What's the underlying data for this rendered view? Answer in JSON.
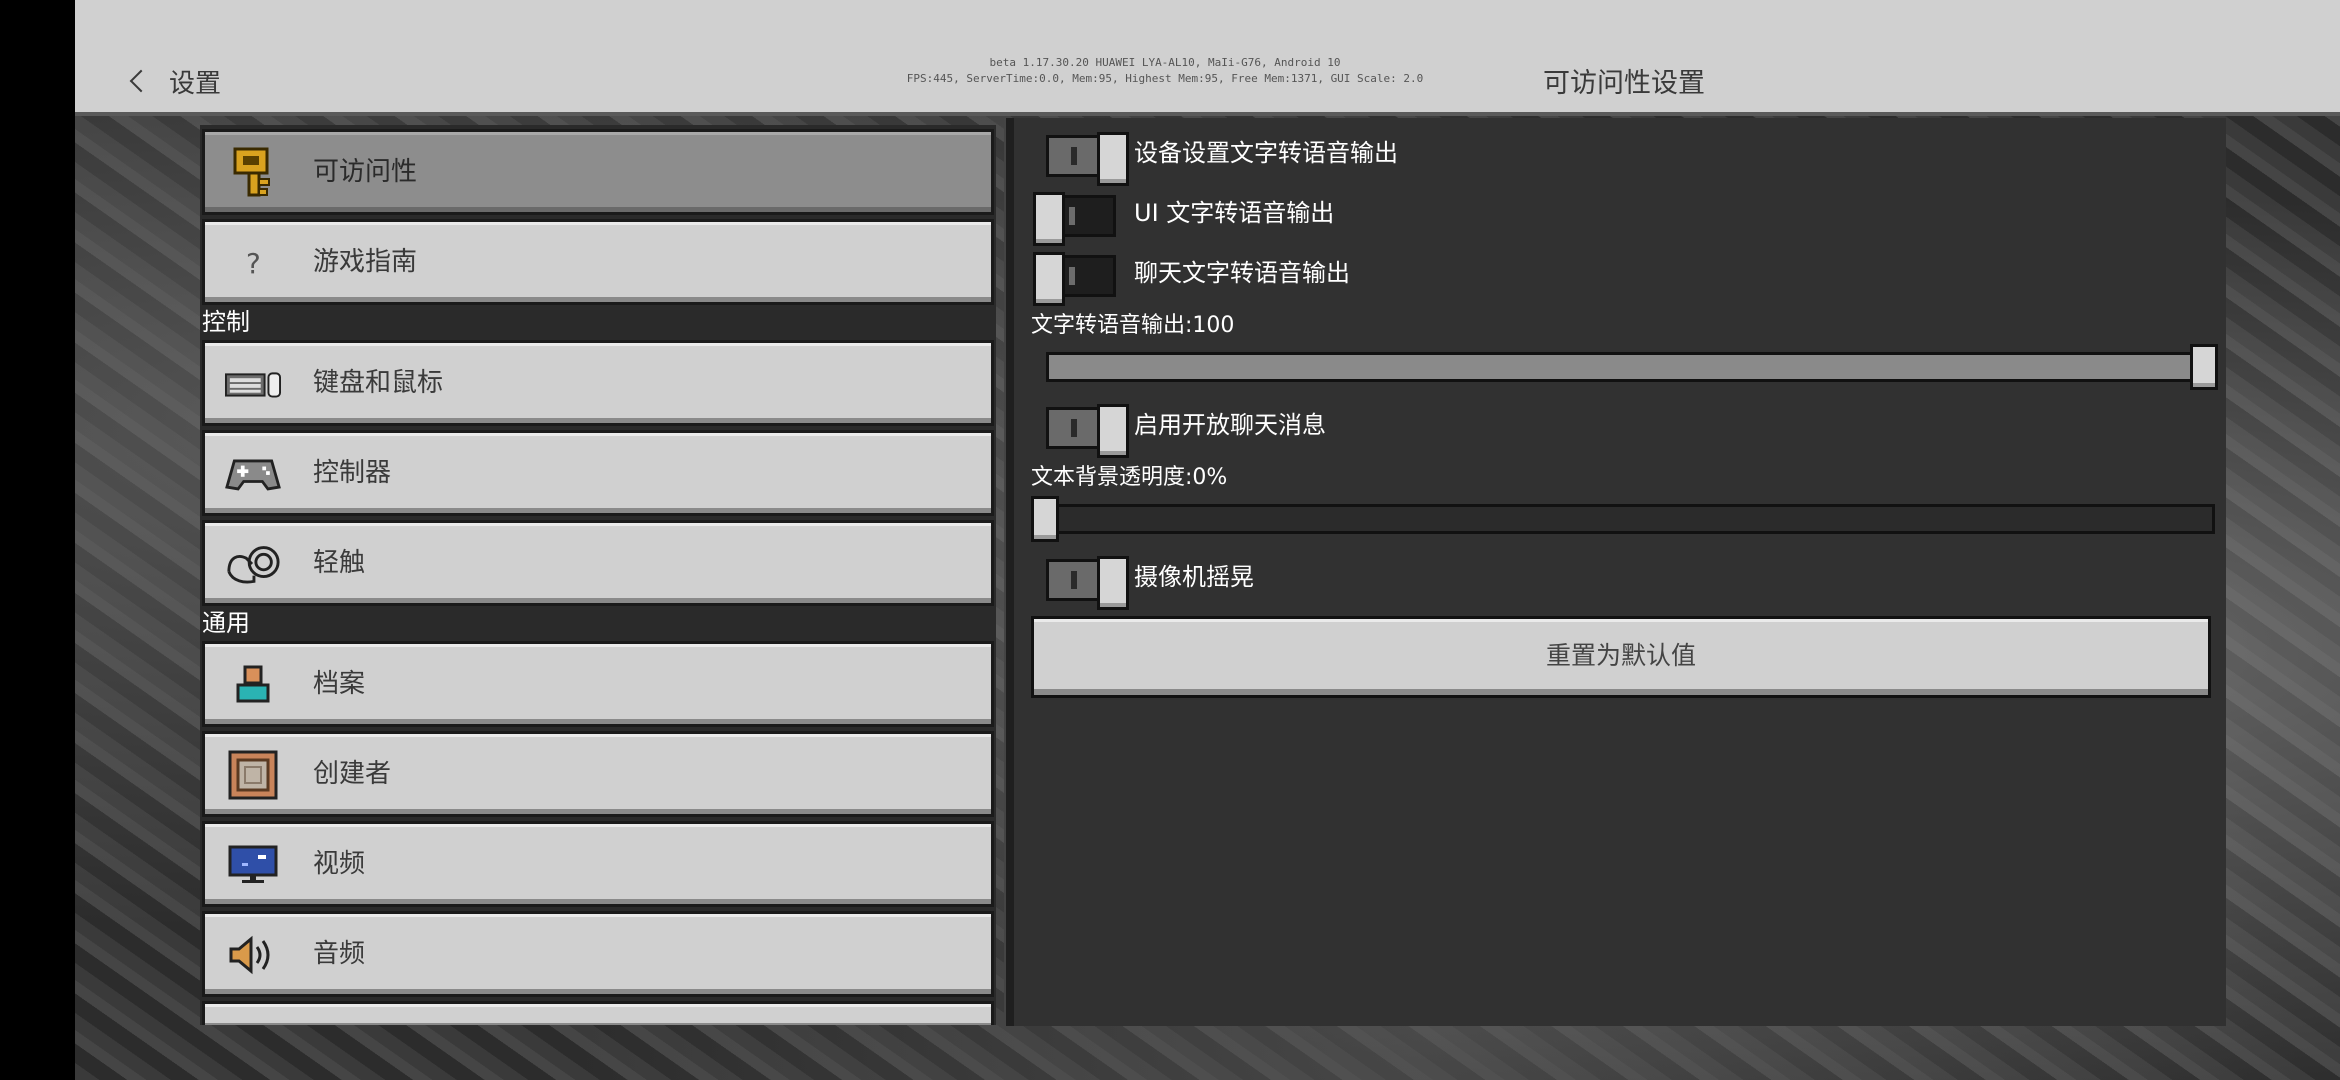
{
  "header": {
    "back_label": "设置",
    "debug_line1": "beta 1.17.30.20 HUAWEI LYA-AL10, MaIi-G76, Android 10",
    "debug_line2": "FPS:445, ServerTime:0.0, Mem:95, Highest Mem:95, Free Mem:1371, GUI Scale: 2.0",
    "title": "可访问性设置"
  },
  "sidebar": {
    "top_items": [
      {
        "label": "可访问性",
        "icon": "key-icon",
        "active": true
      },
      {
        "label": "游戏指南",
        "icon": "question-icon",
        "active": false
      }
    ],
    "sections": [
      {
        "title": "控制",
        "items": [
          {
            "label": "键盘和鼠标",
            "icon": "keyboard-mouse-icon"
          },
          {
            "label": "控制器",
            "icon": "gamepad-icon"
          },
          {
            "label": "轻触",
            "icon": "touch-icon"
          }
        ]
      },
      {
        "title": "通用",
        "items": [
          {
            "label": "档案",
            "icon": "profile-icon"
          },
          {
            "label": "创建者",
            "icon": "creator-icon"
          },
          {
            "label": "视频",
            "icon": "monitor-icon"
          },
          {
            "label": "音频",
            "icon": "speaker-icon"
          }
        ]
      }
    ]
  },
  "settings": {
    "toggle_device_tts": {
      "label": "设备设置文字转语音输出",
      "on": true
    },
    "toggle_ui_tts": {
      "label": "UI 文字转语音输出",
      "on": false
    },
    "toggle_chat_tts": {
      "label": "聊天文字转语音输出",
      "on": false
    },
    "slider_tts": {
      "label": "文字转语音输出:100",
      "value": 100,
      "max": 100
    },
    "toggle_open_chat": {
      "label": "启用开放聊天消息",
      "on": true
    },
    "slider_text_bg": {
      "label": "文本背景透明度:0%",
      "value": 0,
      "max": 100
    },
    "toggle_camera_shake": {
      "label": "摄像机摇晃",
      "on": true
    },
    "reset_label": "重置为默认值"
  },
  "colors": {
    "panel_bg": "#313131",
    "button_bg": "#d0d0d0",
    "active_bg": "#8d8d8d"
  }
}
